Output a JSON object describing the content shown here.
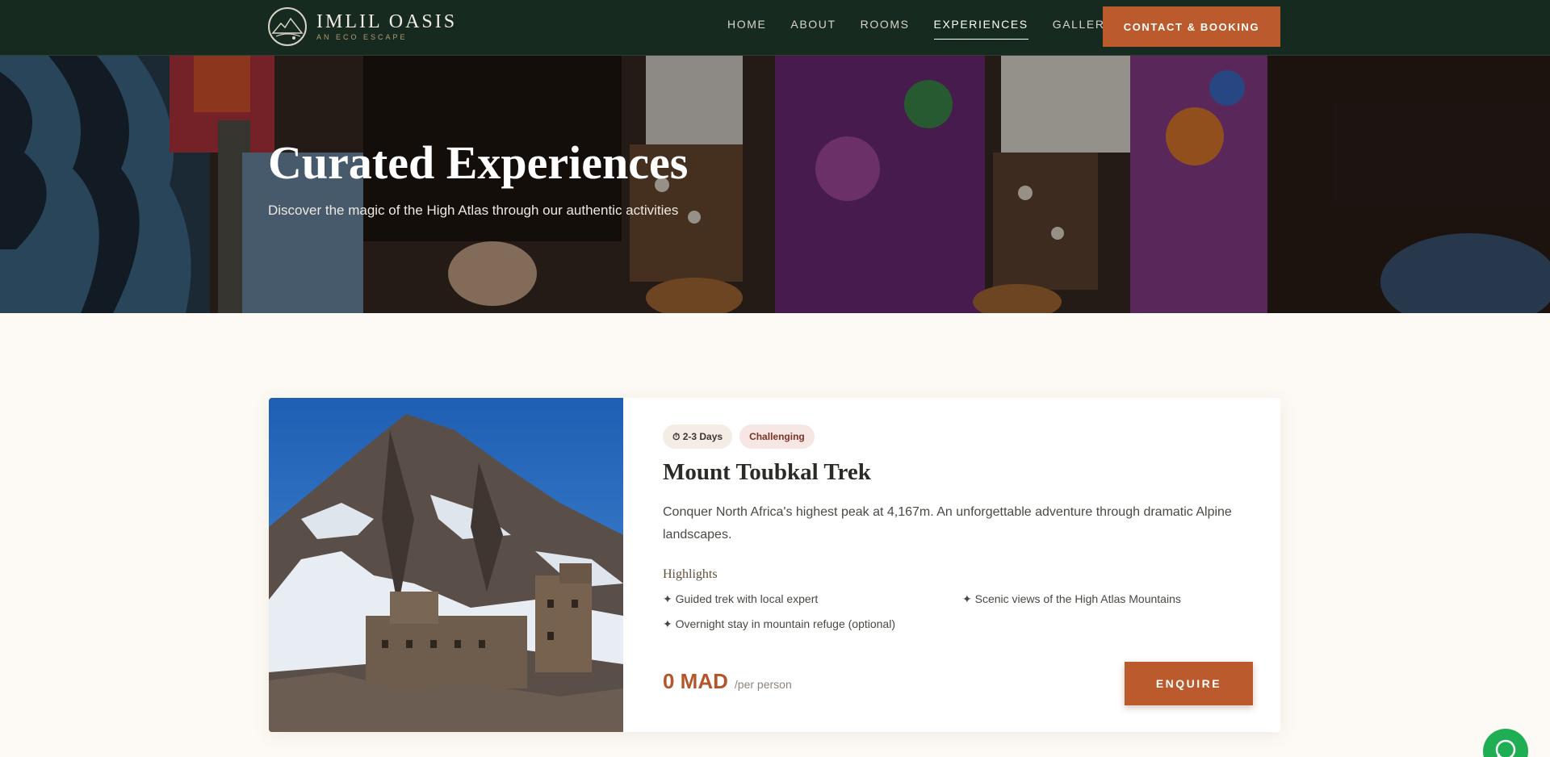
{
  "header": {
    "brand_name": "IMLIL OASIS",
    "brand_tagline": "AN ECO ESCAPE",
    "nav": [
      {
        "label": "HOME"
      },
      {
        "label": "ABOUT"
      },
      {
        "label": "ROOMS"
      },
      {
        "label": "EXPERIENCES",
        "active": true
      },
      {
        "label": "GALLERY"
      }
    ],
    "cta_label": "CONTACT & BOOKING"
  },
  "hero": {
    "title": "Curated Experiences",
    "subtitle": "Discover the magic of the High Atlas through our authentic activities"
  },
  "experience": {
    "duration_badge": "⏱ 2-3 Days",
    "difficulty_badge": "Challenging",
    "title": "Mount Toubkal Trek",
    "description": "Conquer North Africa's highest peak at 4,167m. An unforgettable adventure through dramatic Alpine landscapes.",
    "highlights_title": "Highlights",
    "highlights": [
      "✦ Guided trek with local expert",
      "✦ Scenic views of the High Atlas Mountains",
      "✦ Overnight stay in mountain refuge (optional)"
    ],
    "price": "0 MAD",
    "price_unit": "/per person",
    "enquire_label": "ENQUIRE"
  },
  "colors": {
    "header_bg": "#162a1f",
    "accent": "#bb5a2c",
    "page_bg": "#fdf9f4",
    "whatsapp": "#1fae53"
  },
  "icons": [
    "mountain-logo-icon",
    "timer-icon",
    "whatsapp-icon"
  ]
}
